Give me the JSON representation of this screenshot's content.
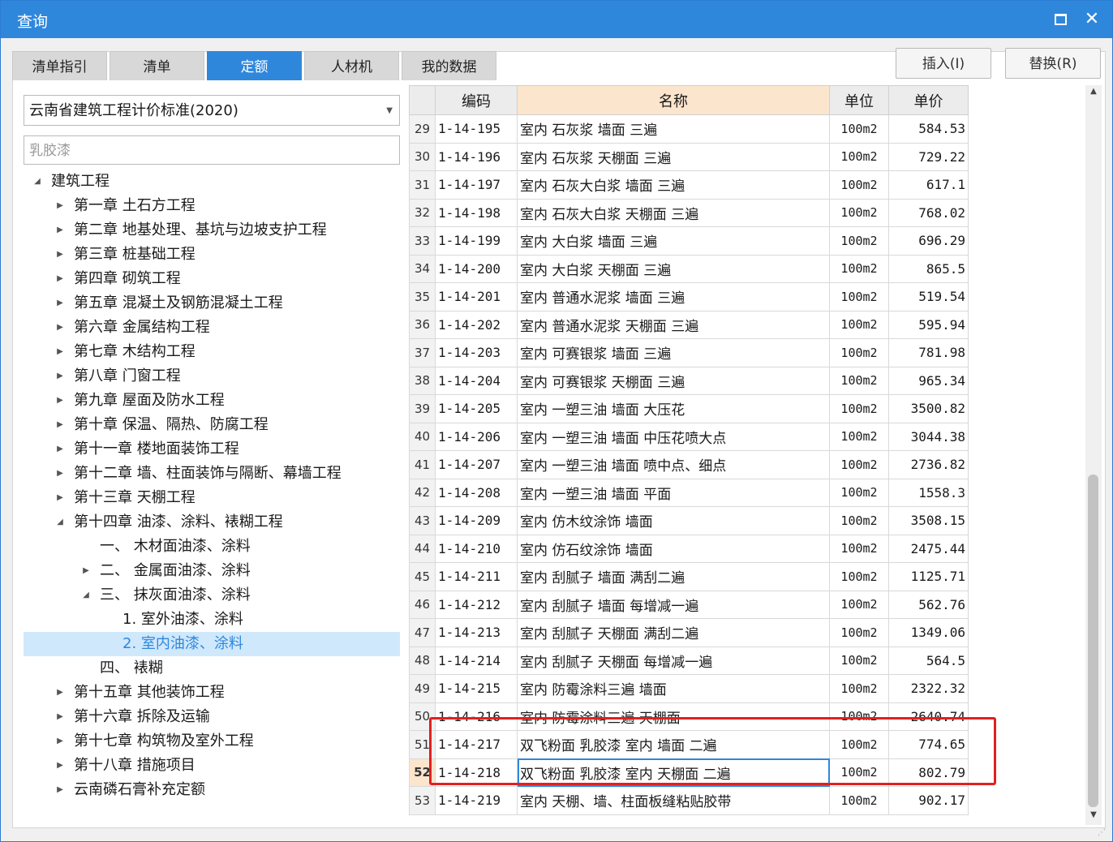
{
  "window": {
    "title": "查询"
  },
  "tabs": [
    {
      "label": "清单指引",
      "active": false
    },
    {
      "label": "清单",
      "active": false
    },
    {
      "label": "定额",
      "active": true
    },
    {
      "label": "人材机",
      "active": false
    },
    {
      "label": "我的数据",
      "active": false
    }
  ],
  "buttons": {
    "insert": "插入(I)",
    "replace": "替换(R)"
  },
  "standard_select": {
    "value": "云南省建筑工程计价标准(2020)"
  },
  "search": {
    "value": "乳胶漆"
  },
  "tree": [
    {
      "label": "建筑工程",
      "level": 0,
      "arrow": "expanded"
    },
    {
      "label": "第一章 土石方工程",
      "level": 1,
      "arrow": "collapsed"
    },
    {
      "label": "第二章 地基处理、基坑与边坡支护工程",
      "level": 1,
      "arrow": "collapsed"
    },
    {
      "label": "第三章 桩基础工程",
      "level": 1,
      "arrow": "collapsed"
    },
    {
      "label": "第四章 砌筑工程",
      "level": 1,
      "arrow": "collapsed"
    },
    {
      "label": "第五章 混凝土及钢筋混凝土工程",
      "level": 1,
      "arrow": "collapsed"
    },
    {
      "label": "第六章 金属结构工程",
      "level": 1,
      "arrow": "collapsed"
    },
    {
      "label": "第七章 木结构工程",
      "level": 1,
      "arrow": "collapsed"
    },
    {
      "label": "第八章 门窗工程",
      "level": 1,
      "arrow": "collapsed"
    },
    {
      "label": "第九章 屋面及防水工程",
      "level": 1,
      "arrow": "collapsed"
    },
    {
      "label": "第十章 保温、隔热、防腐工程",
      "level": 1,
      "arrow": "collapsed"
    },
    {
      "label": "第十一章 楼地面装饰工程",
      "level": 1,
      "arrow": "collapsed"
    },
    {
      "label": "第十二章 墙、柱面装饰与隔断、幕墙工程",
      "level": 1,
      "arrow": "collapsed"
    },
    {
      "label": "第十三章 天棚工程",
      "level": 1,
      "arrow": "collapsed"
    },
    {
      "label": "第十四章 油漆、涂料、裱糊工程",
      "level": 1,
      "arrow": "expanded"
    },
    {
      "label": "一、 木材面油漆、涂料",
      "level": 2,
      "arrow": "none"
    },
    {
      "label": "二、 金属面油漆、涂料",
      "level": 2,
      "arrow": "collapsed"
    },
    {
      "label": "三、 抹灰面油漆、涂料",
      "level": 2,
      "arrow": "expanded"
    },
    {
      "label": "1. 室外油漆、涂料",
      "level": 3,
      "arrow": "none"
    },
    {
      "label": "2. 室内油漆、涂料",
      "level": 3,
      "arrow": "none",
      "selected": true
    },
    {
      "label": "四、 裱糊",
      "level": 2,
      "arrow": "none"
    },
    {
      "label": "第十五章 其他装饰工程",
      "level": 1,
      "arrow": "collapsed"
    },
    {
      "label": "第十六章 拆除及运输",
      "level": 1,
      "arrow": "collapsed"
    },
    {
      "label": "第十七章 构筑物及室外工程",
      "level": 1,
      "arrow": "collapsed"
    },
    {
      "label": "第十八章 措施项目",
      "level": 1,
      "arrow": "collapsed"
    },
    {
      "label": "云南磷石膏补充定额",
      "level": 1,
      "arrow": "collapsed"
    }
  ],
  "table": {
    "headers": {
      "code": "编码",
      "name": "名称",
      "unit": "单位",
      "price": "单价"
    },
    "rows": [
      {
        "n": "29",
        "code": "1-14-195",
        "name": "室内 石灰浆 墙面 三遍",
        "unit": "100m2",
        "price": "584.53"
      },
      {
        "n": "30",
        "code": "1-14-196",
        "name": "室内 石灰浆 天棚面 三遍",
        "unit": "100m2",
        "price": "729.22"
      },
      {
        "n": "31",
        "code": "1-14-197",
        "name": "室内 石灰大白浆 墙面 三遍",
        "unit": "100m2",
        "price": "617.1"
      },
      {
        "n": "32",
        "code": "1-14-198",
        "name": "室内 石灰大白浆 天棚面 三遍",
        "unit": "100m2",
        "price": "768.02"
      },
      {
        "n": "33",
        "code": "1-14-199",
        "name": "室内 大白浆 墙面 三遍",
        "unit": "100m2",
        "price": "696.29"
      },
      {
        "n": "34",
        "code": "1-14-200",
        "name": "室内 大白浆 天棚面 三遍",
        "unit": "100m2",
        "price": "865.5"
      },
      {
        "n": "35",
        "code": "1-14-201",
        "name": "室内 普通水泥浆 墙面 三遍",
        "unit": "100m2",
        "price": "519.54"
      },
      {
        "n": "36",
        "code": "1-14-202",
        "name": "室内 普通水泥浆 天棚面 三遍",
        "unit": "100m2",
        "price": "595.94"
      },
      {
        "n": "37",
        "code": "1-14-203",
        "name": "室内 可赛银浆 墙面 三遍",
        "unit": "100m2",
        "price": "781.98"
      },
      {
        "n": "38",
        "code": "1-14-204",
        "name": "室内 可赛银浆 天棚面 三遍",
        "unit": "100m2",
        "price": "965.34"
      },
      {
        "n": "39",
        "code": "1-14-205",
        "name": "室内 一塑三油 墙面 大压花",
        "unit": "100m2",
        "price": "3500.82"
      },
      {
        "n": "40",
        "code": "1-14-206",
        "name": "室内 一塑三油 墙面 中压花喷大点",
        "unit": "100m2",
        "price": "3044.38"
      },
      {
        "n": "41",
        "code": "1-14-207",
        "name": "室内 一塑三油 墙面 喷中点、细点",
        "unit": "100m2",
        "price": "2736.82"
      },
      {
        "n": "42",
        "code": "1-14-208",
        "name": "室内 一塑三油 墙面 平面",
        "unit": "100m2",
        "price": "1558.3"
      },
      {
        "n": "43",
        "code": "1-14-209",
        "name": "室内 仿木纹涂饰 墙面",
        "unit": "100m2",
        "price": "3508.15"
      },
      {
        "n": "44",
        "code": "1-14-210",
        "name": "室内 仿石纹涂饰 墙面",
        "unit": "100m2",
        "price": "2475.44"
      },
      {
        "n": "45",
        "code": "1-14-211",
        "name": "室内 刮腻子 墙面 满刮二遍",
        "unit": "100m2",
        "price": "1125.71"
      },
      {
        "n": "46",
        "code": "1-14-212",
        "name": "室内 刮腻子 墙面 每增减一遍",
        "unit": "100m2",
        "price": "562.76"
      },
      {
        "n": "47",
        "code": "1-14-213",
        "name": "室内 刮腻子 天棚面 满刮二遍",
        "unit": "100m2",
        "price": "1349.06"
      },
      {
        "n": "48",
        "code": "1-14-214",
        "name": "室内 刮腻子 天棚面 每增减一遍",
        "unit": "100m2",
        "price": "564.5"
      },
      {
        "n": "49",
        "code": "1-14-215",
        "name": "室内 防霉涂料三遍 墙面",
        "unit": "100m2",
        "price": "2322.32"
      },
      {
        "n": "50",
        "code": "1-14-216",
        "name": "室内 防霉涂料三遍 天棚面",
        "unit": "100m2",
        "price": "2640.74"
      },
      {
        "n": "51",
        "code": "1-14-217",
        "name": "双飞粉面 乳胶漆 室内 墙面 二遍",
        "unit": "100m2",
        "price": "774.65"
      },
      {
        "n": "52",
        "code": "1-14-218",
        "name": "双飞粉面 乳胶漆 室内 天棚面 二遍",
        "unit": "100m2",
        "price": "802.79",
        "current": true
      },
      {
        "n": "53",
        "code": "1-14-219",
        "name": "室内 天棚、墙、柱面板缝粘贴胶带",
        "unit": "100m2",
        "price": "902.17"
      }
    ]
  },
  "colors": {
    "accent": "#2f87dc",
    "highlight_box": "#e02020",
    "header_name_bg": "#fce5cd",
    "selected_tree_bg": "#cfe8fc"
  }
}
